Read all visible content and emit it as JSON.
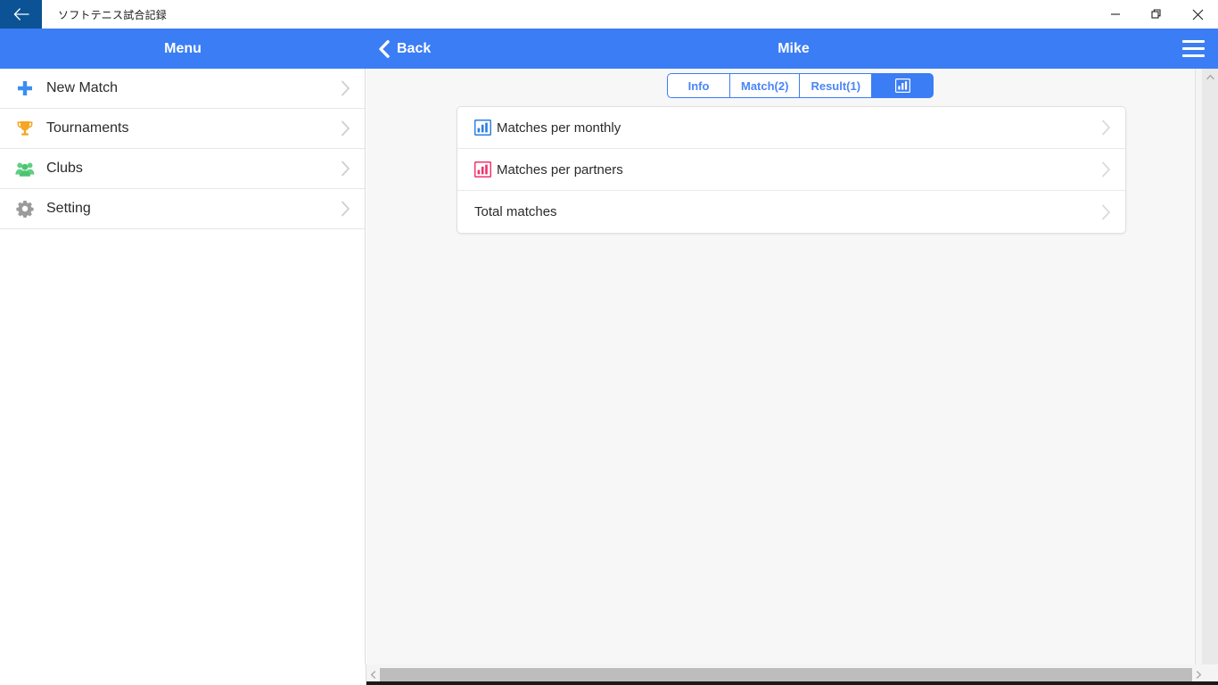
{
  "window": {
    "title": "ソフトテニス試合記録",
    "back_icon": "arrow-left-icon",
    "minimize_label": "Minimize",
    "maximize_label": "Restore",
    "close_label": "Close"
  },
  "appbar": {
    "menu_label": "Menu",
    "back_label": "Back",
    "back_icon": "chevron-left-icon",
    "page_title": "Mike",
    "hamburger_icon": "hamburger-menu-icon",
    "accent_color": "#3b7df5"
  },
  "sidebar": {
    "items": [
      {
        "label": "New Match",
        "icon": "plus-icon",
        "icon_color": "#3b8ef0"
      },
      {
        "label": "Tournaments",
        "icon": "trophy-icon",
        "icon_color": "#f5a623"
      },
      {
        "label": "Clubs",
        "icon": "people-icon",
        "icon_color": "#5ecf82"
      },
      {
        "label": "Setting",
        "icon": "gear-icon",
        "icon_color": "#9b9b9b"
      }
    ],
    "chevron_icon": "chevron-right-icon"
  },
  "tabs": [
    {
      "label": "Info",
      "active": false
    },
    {
      "label": "Match(2)",
      "active": false
    },
    {
      "label": "Result(1)",
      "active": false
    },
    {
      "label": "",
      "icon": "bar-chart-icon",
      "active": true
    }
  ],
  "list": {
    "rows": [
      {
        "label": "Matches per monthly",
        "icon": "bar-chart-icon",
        "icon_color": "#2a7fe0"
      },
      {
        "label": "Matches per partners",
        "icon": "bar-chart-icon",
        "icon_color": "#f2326b"
      },
      {
        "label": "Total matches",
        "icon": "",
        "icon_color": ""
      }
    ],
    "chevron_icon": "chevron-right-icon"
  },
  "scrollbars": {
    "vertical_up_icon": "chevron-up-icon",
    "vertical_down_icon": "chevron-down-icon",
    "horizontal_left_icon": "chevron-left-icon",
    "horizontal_right_icon": "chevron-right-icon"
  }
}
